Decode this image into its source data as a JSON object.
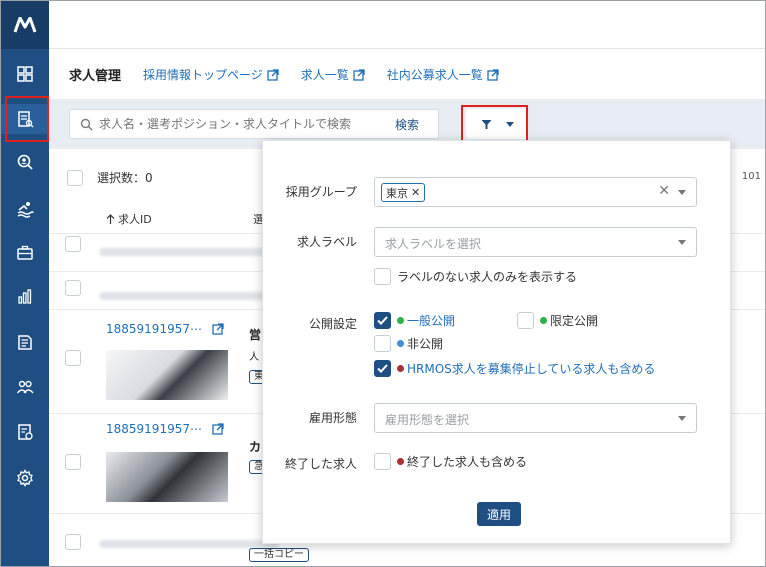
{
  "sidebar": {
    "logo_icon": "brand-logo",
    "items": [
      {
        "icon": "dashboard-icon"
      },
      {
        "icon": "job-posting-icon"
      },
      {
        "icon": "candidate-search-icon"
      },
      {
        "icon": "swim-icon"
      },
      {
        "icon": "briefcase-icon"
      },
      {
        "icon": "bar-chart-icon"
      },
      {
        "icon": "document-icon"
      },
      {
        "icon": "users-icon"
      },
      {
        "icon": "checklist-icon"
      },
      {
        "icon": "gear-icon"
      }
    ],
    "active_index": 1
  },
  "nav": {
    "title": "求人管理",
    "links": [
      "採用情報トップページ",
      "求人一覧",
      "社内公募求人一覧"
    ]
  },
  "search": {
    "placeholder": "求人名・選考ポジション・求人タイトルで検索",
    "button_label": "検索"
  },
  "list": {
    "selected_count_label": "選択数：0",
    "col_job_id": "求人ID",
    "col_second_initial": "選",
    "right_count_fragment": "101",
    "rows": [
      {
        "job_id": "18859191957⋯",
        "title_fragment": "営",
        "subtitle_fragment": "人",
        "tag_fragment": "東"
      },
      {
        "job_id": "18859191957⋯",
        "title_fragment": "カ",
        "tag_fragment": "急"
      }
    ],
    "bottom_copy_fragment": "一括コピー"
  },
  "filter_panel": {
    "hiring_group": {
      "label": "採用グループ",
      "selected_chip": "東京"
    },
    "job_label": {
      "label": "求人ラベル",
      "placeholder": "求人ラベルを選択",
      "only_unlabeled": "ラベルのない求人のみを表示する"
    },
    "publication": {
      "label": "公開設定",
      "public": "一般公開",
      "limited": "限定公開",
      "private": "非公開",
      "include_hrmos_stopped": "HRMOS求人を募集停止している求人も含める"
    },
    "employment_type": {
      "label": "雇用形態",
      "placeholder": "雇用形態を選択"
    },
    "ended": {
      "label": "終了した求人",
      "include_ended": "終了した求人も含める"
    },
    "apply_label": "適用"
  },
  "colors": {
    "sidebar": "#1f4f82",
    "accent_link": "#1f6fb8",
    "dot_green": "#2bb34a",
    "dot_blue": "#3f8fd8",
    "dot_red": "#a83232",
    "highlight": "#e0201b"
  }
}
